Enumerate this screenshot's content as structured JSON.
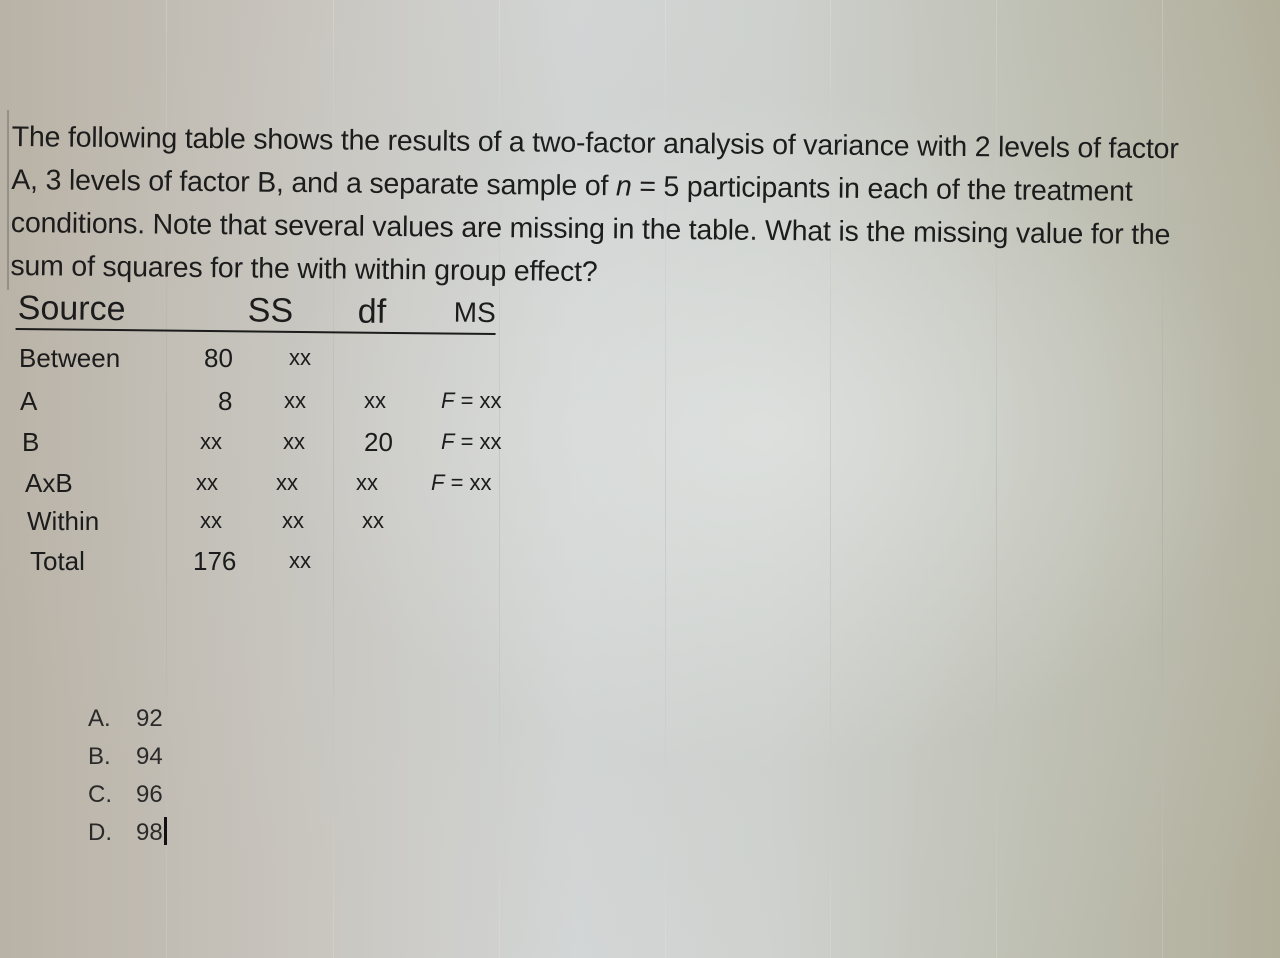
{
  "question": {
    "line1": "The following table shows the results of a two-factor analysis of variance with 2 levels of factor",
    "line2_part1": "A, 3 levels of factor B, and a separate sample of ",
    "line2_var": "n",
    "line2_part2": " = 5 participants in each of the treatment",
    "line3": "conditions. Note that several values are missing in the table. What is the missing value for the",
    "line4": "sum of squares for the with within group effect?"
  },
  "table": {
    "headers": {
      "source": "Source",
      "ss": "SS",
      "df": "df",
      "ms": "MS"
    },
    "rows": [
      {
        "source": "Between",
        "ss": "80",
        "df": "xx",
        "ms": "",
        "f": ""
      },
      {
        "source": "A",
        "ss": "8",
        "df": "xx",
        "ms": "xx",
        "f_label": "F",
        "f_value": " = xx"
      },
      {
        "source": "B",
        "ss": "xx",
        "df": "xx",
        "ms": "20",
        "f_label": "F",
        "f_value": " = xx"
      },
      {
        "source": "AxB",
        "ss": "xx",
        "df": "xx",
        "ms": "xx",
        "f_label": "F",
        "f_value": " = xx"
      },
      {
        "source": "Within",
        "ss": "xx",
        "df": "xx",
        "ms": "xx",
        "f": ""
      },
      {
        "source": "Total",
        "ss": "176",
        "df": "xx",
        "ms": "",
        "f": ""
      }
    ]
  },
  "options": [
    {
      "letter": "A.",
      "value": "92"
    },
    {
      "letter": "B.",
      "value": "94"
    },
    {
      "letter": "C.",
      "value": "96"
    },
    {
      "letter": "D.",
      "value": "98"
    }
  ]
}
